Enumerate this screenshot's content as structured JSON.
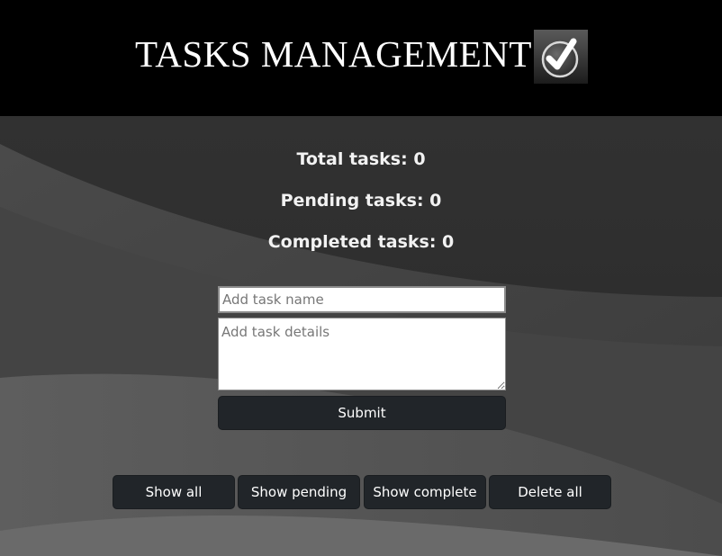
{
  "header": {
    "title": "TASKS MANAGEMENT",
    "logo_icon": "checkmark-badge-icon"
  },
  "stats": {
    "total": "Total tasks: 0",
    "pending": "Pending tasks: 0",
    "completed": "Completed tasks: 0"
  },
  "form": {
    "name_placeholder": "Add task name",
    "name_value": "",
    "details_placeholder": "Add task details",
    "details_value": "",
    "submit_label": "Submit"
  },
  "filters": {
    "show_all": "Show all",
    "show_pending": "Show pending",
    "show_complete": "Show complete",
    "delete_all": "Delete all"
  },
  "colors": {
    "header_bg": "#000000",
    "button_bg": "#212529",
    "text": "#ffffff"
  }
}
